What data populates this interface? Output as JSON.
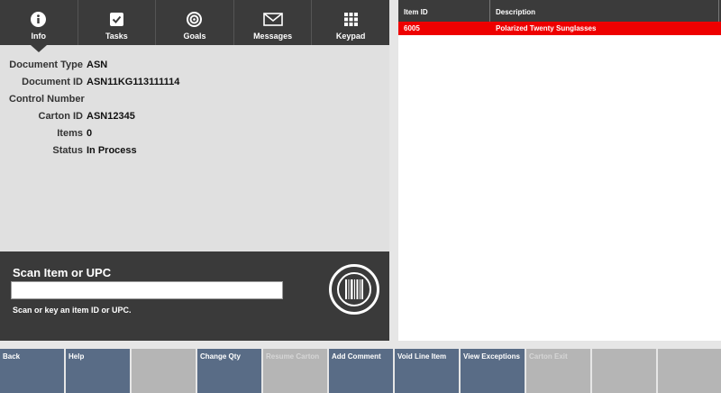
{
  "tabs": [
    {
      "label": "Info",
      "icon": "info-icon"
    },
    {
      "label": "Tasks",
      "icon": "checkbox-icon"
    },
    {
      "label": "Goals",
      "icon": "target-icon"
    },
    {
      "label": "Messages",
      "icon": "envelope-icon"
    },
    {
      "label": "Keypad",
      "icon": "keypad-icon"
    }
  ],
  "details": [
    {
      "key": "Document Type",
      "value": "ASN"
    },
    {
      "key": "Document ID",
      "value": "ASN11KG113111114"
    },
    {
      "key": "Control Number",
      "value": ""
    },
    {
      "key": "Carton ID",
      "value": "ASN12345"
    },
    {
      "key": "Items",
      "value": "0"
    },
    {
      "key": "Status",
      "value": "In Process"
    }
  ],
  "scan": {
    "title": "Scan Item or UPC",
    "value": "",
    "hint": "Scan or key an item ID or UPC."
  },
  "table": {
    "headers": [
      "Item ID",
      "Description"
    ],
    "rows": [
      [
        "6005",
        "Polarized Twenty Sunglasses"
      ]
    ]
  },
  "actions": [
    {
      "label": "Back",
      "enabled": true
    },
    {
      "label": "Help",
      "enabled": true
    },
    {
      "label": "",
      "enabled": false
    },
    {
      "label": "Change Qty",
      "enabled": true
    },
    {
      "label": "Resume Carton",
      "enabled": false
    },
    {
      "label": "Add Comment",
      "enabled": true
    },
    {
      "label": "Void Line Item",
      "enabled": true
    },
    {
      "label": "View Exceptions",
      "enabled": true
    },
    {
      "label": "Carton Exit",
      "enabled": false
    },
    {
      "label": "",
      "enabled": false
    },
    {
      "label": "",
      "enabled": false
    }
  ],
  "colors": {
    "header_dark": "#3b3b3b",
    "selected_row": "#ee0000",
    "action_button": "#596c86",
    "action_disabled": "#b5b5b5"
  }
}
